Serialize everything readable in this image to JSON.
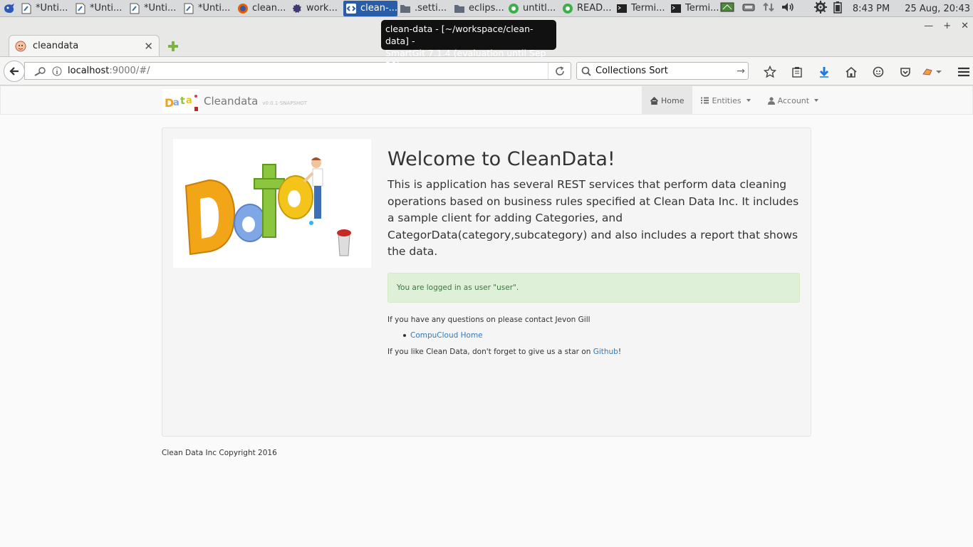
{
  "taskbar": {
    "tasks": [
      {
        "label": "*Unti...",
        "icon": "document-icon",
        "active": false
      },
      {
        "label": "*Unti...",
        "icon": "document-icon",
        "active": false
      },
      {
        "label": "*Unti...",
        "icon": "document-icon",
        "active": false
      },
      {
        "label": "*Unti...",
        "icon": "document-icon",
        "active": false
      },
      {
        "label": "clean...",
        "icon": "firefox-icon",
        "active": false
      },
      {
        "label": "work...",
        "icon": "eclipse-icon",
        "active": false
      },
      {
        "label": "clean-...",
        "icon": "smartgit-icon",
        "active": true
      },
      {
        "label": ".setti...",
        "icon": "folder-icon",
        "active": false
      },
      {
        "label": "eclips...",
        "icon": "folder-icon",
        "active": false
      },
      {
        "label": "untitl...",
        "icon": "chrome-icon",
        "active": false
      },
      {
        "label": "READ...",
        "icon": "chrome-icon",
        "active": false
      },
      {
        "label": "Termi...",
        "icon": "terminal-icon",
        "active": false
      },
      {
        "label": "Termi...",
        "icon": "terminal-icon",
        "active": false
      }
    ],
    "time": "8:43 PM",
    "date": "25 Aug, 20:43"
  },
  "tooltip": {
    "line1": "clean-data - [~/workspace/clean-data] -",
    "line2": "SmartGit 7.1.4 (evaluation until Sep 20)"
  },
  "browser": {
    "tab_title": "cleandata",
    "url_host": "localhost",
    "url_rest": ":9000/#/",
    "search_value": "Collections Sort"
  },
  "app": {
    "brand_name": "Cleandata",
    "brand_version": "v0.0.1-SNAPSHOT",
    "nav": {
      "home": "Home",
      "entities": "Entities",
      "account": "Account"
    }
  },
  "main": {
    "title": "Welcome to CleanData!",
    "description": "This is application has several REST services that perform data cleaning operations based on business rules specified at Clean Data Inc. It includes a sample client for adding Categories, and CategorData(category,subcategory) and also includes a report that shows the data.",
    "alert": "You are logged in as user \"user\".",
    "questions": "If you have any questions on please contact Jevon Gill",
    "link_home": "CompuCloud Home",
    "star_prefix": "If you like Clean Data, don't forget to give us a star on ",
    "star_link": "Github",
    "star_suffix": "!"
  },
  "footer": {
    "text": "Clean Data Inc Copyright 2016"
  },
  "colors": {
    "link": "#337ab7",
    "alert_bg": "#dff0d8",
    "alert_text": "#3c763d",
    "taskbar_active": "#2a5da8"
  }
}
